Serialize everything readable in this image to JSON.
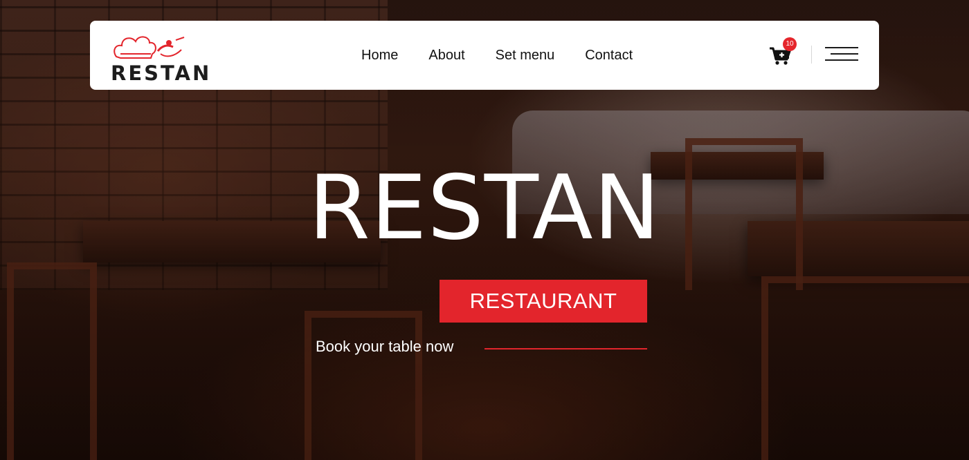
{
  "brand": {
    "name": "RESTAN"
  },
  "nav": {
    "items": [
      {
        "label": "Home"
      },
      {
        "label": "About"
      },
      {
        "label": "Set menu"
      },
      {
        "label": "Contact"
      }
    ]
  },
  "cart": {
    "count": "10",
    "icon": "cart-plus-icon"
  },
  "menu": {
    "icon": "hamburger-menu-icon"
  },
  "hero": {
    "title": "RESTAN",
    "subtitle": "RESTAURANT",
    "cta_label": "Book your table now"
  },
  "colors": {
    "accent": "#e3252c",
    "header_bg": "#ffffff",
    "text_dark": "#111111"
  }
}
